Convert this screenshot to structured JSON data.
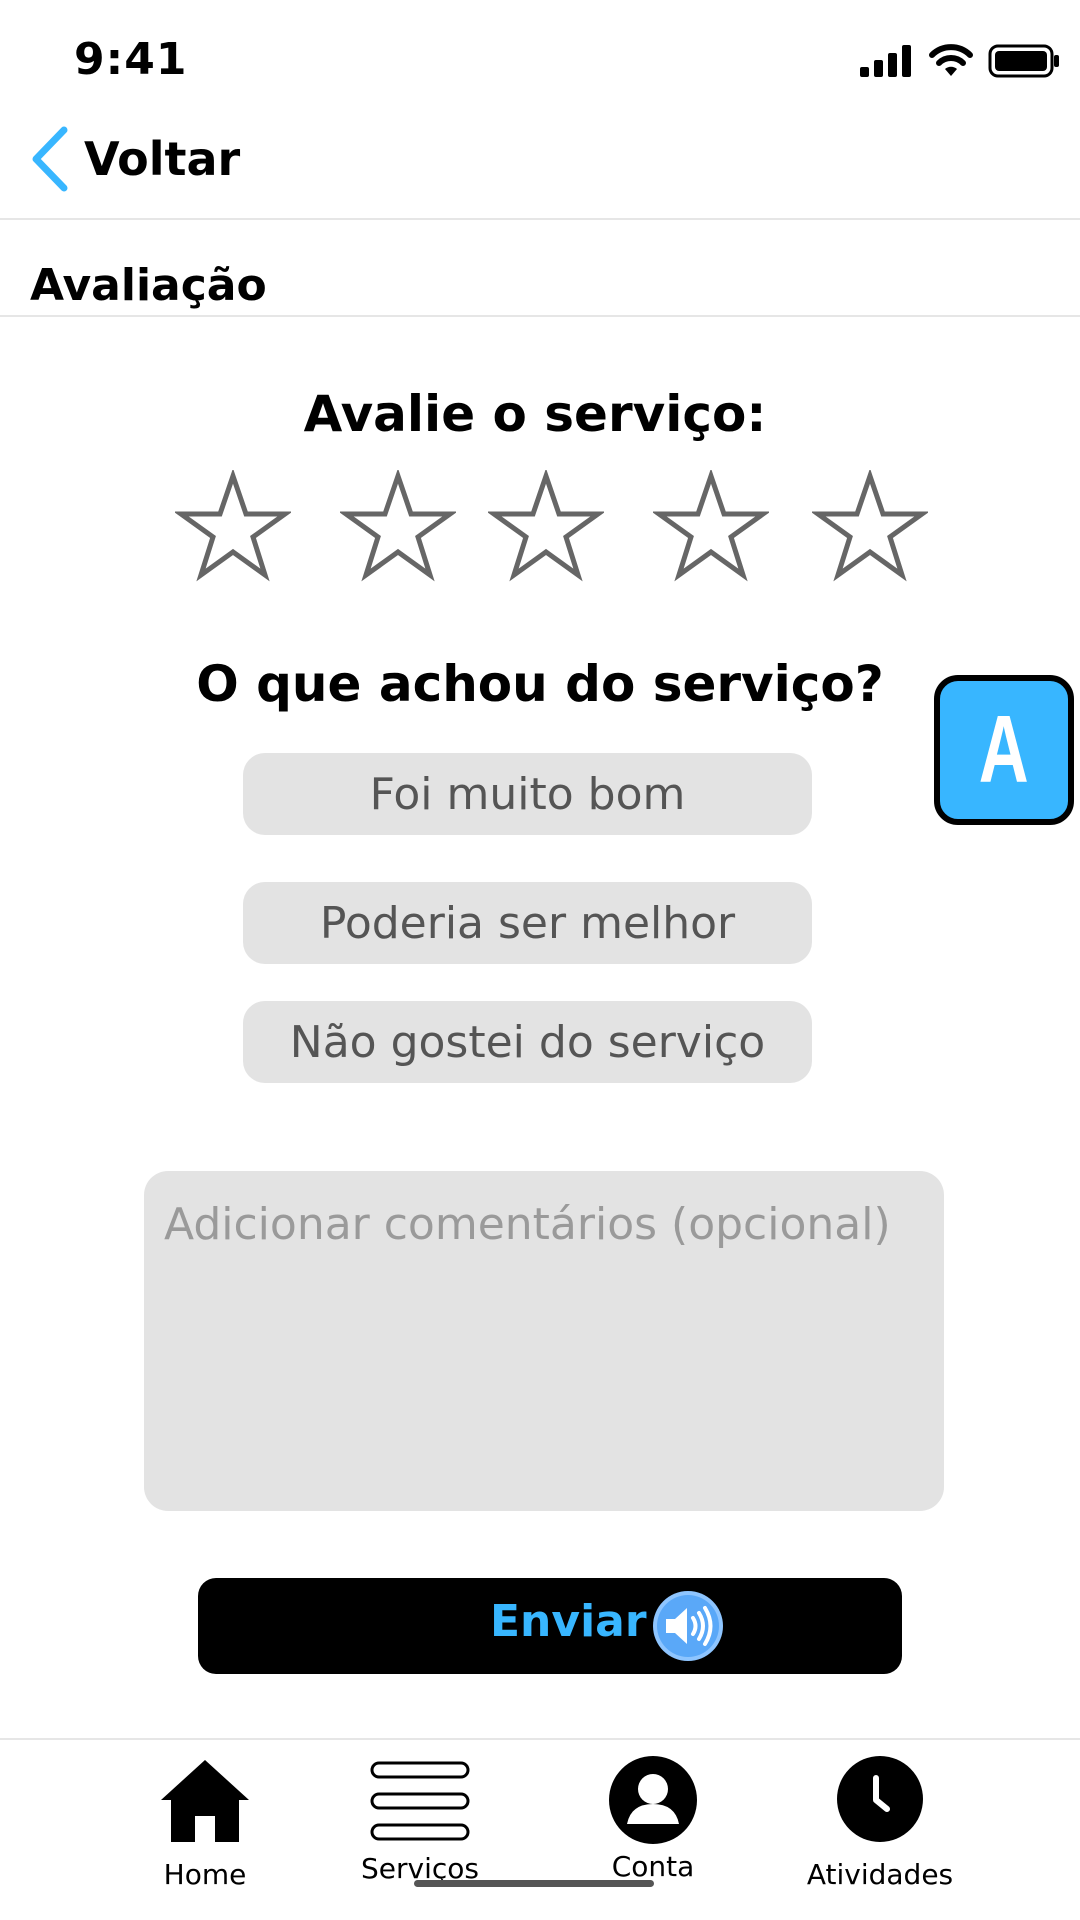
{
  "status_bar": {
    "time": "9:41"
  },
  "nav": {
    "back_label": "Voltar"
  },
  "section": {
    "title": "Avaliação"
  },
  "rating": {
    "title": "Avalie o serviço:",
    "max_stars": 5,
    "selected_stars": 0
  },
  "feedback": {
    "question": "O que achou do serviço?",
    "options": [
      "Foi muito bom",
      "Poderia ser melhor",
      "Não gostei do serviço"
    ]
  },
  "comment": {
    "placeholder": "Adicionar comentários (opcional)",
    "value": ""
  },
  "accessibility_button": {
    "label": "A"
  },
  "submit": {
    "label": "Enviar"
  },
  "tabbar": {
    "items": [
      {
        "label": "Home",
        "icon": "home-icon"
      },
      {
        "label": "Serviços",
        "icon": "list-icon"
      },
      {
        "label": "Conta",
        "icon": "user-icon"
      },
      {
        "label": "Atividades",
        "icon": "clock-icon"
      }
    ]
  },
  "colors": {
    "accent": "#38b6ff",
    "option_bg": "#e3e3e3",
    "star_stroke": "#666666",
    "button_bg": "#000000"
  }
}
